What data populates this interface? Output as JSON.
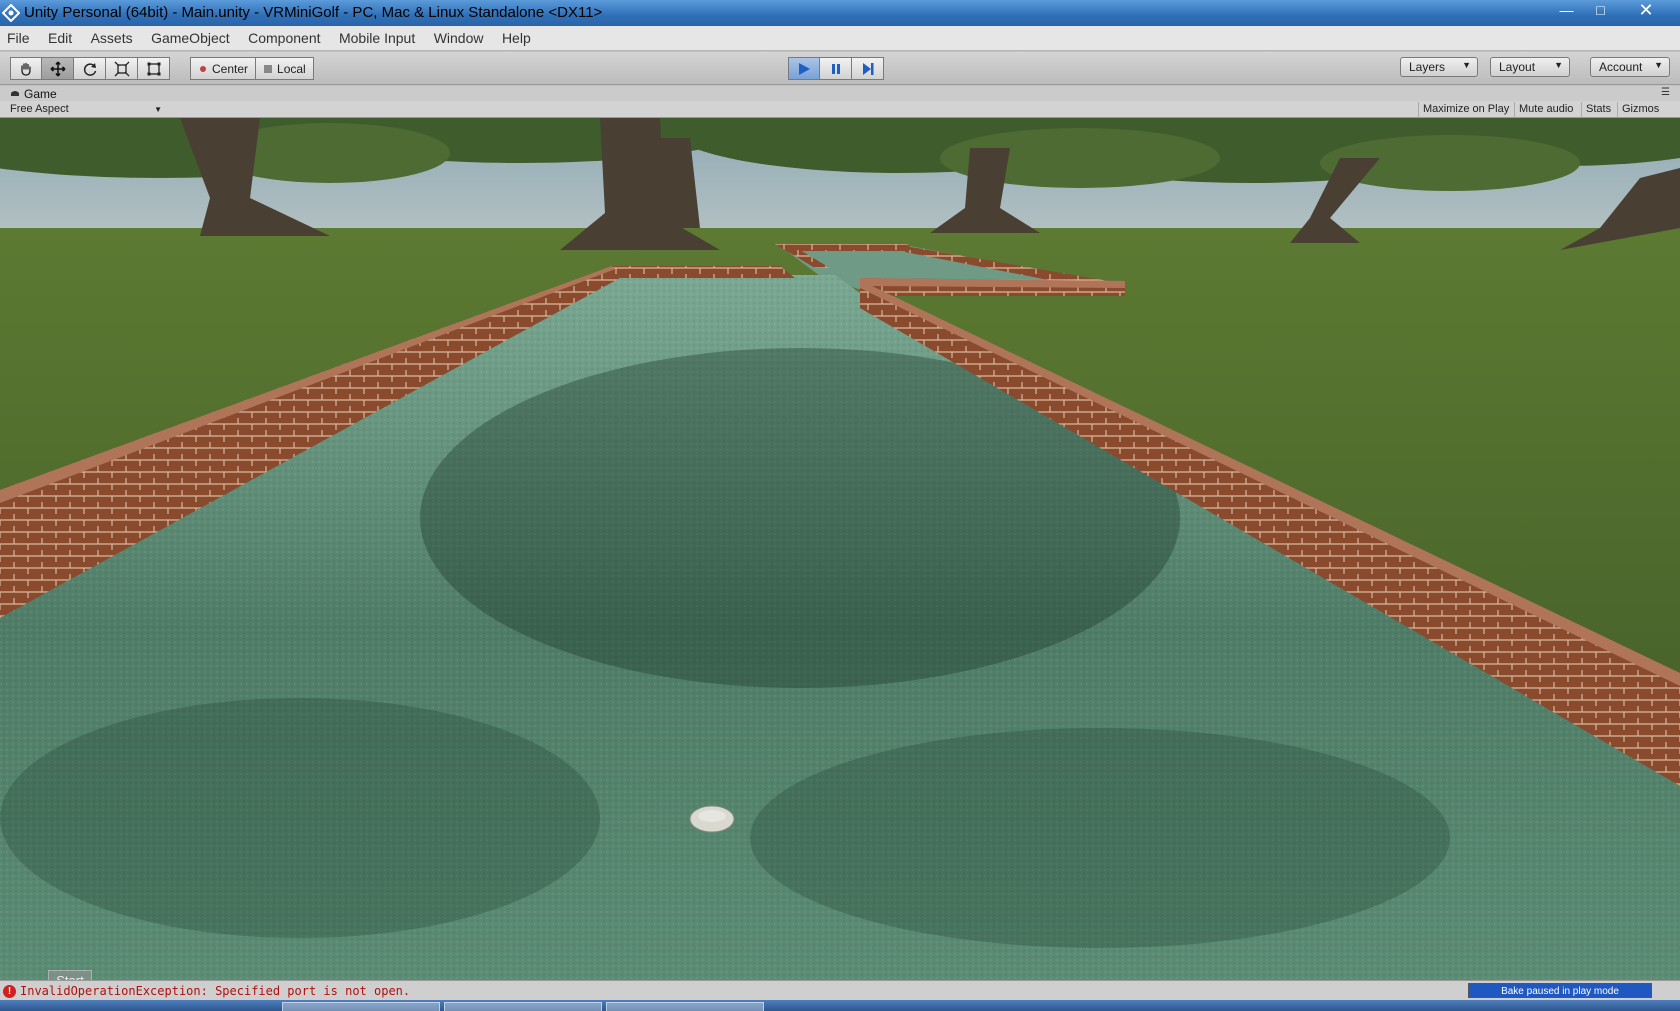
{
  "window": {
    "title": "Unity Personal (64bit) - Main.unity - VRMiniGolf - PC, Mac & Linux Standalone <DX11>",
    "minimize_glyph": "—",
    "maximize_glyph": "□",
    "close_glyph": "✕"
  },
  "menu": [
    "File",
    "Edit",
    "Assets",
    "GameObject",
    "Component",
    "Mobile Input",
    "Window",
    "Help"
  ],
  "toolbar": {
    "tools": [
      "hand-icon",
      "move-icon",
      "rotate-icon",
      "scale-icon",
      "rect-icon"
    ],
    "active_tool": "move-icon",
    "pivot_mode": "Center",
    "pivot_space": "Local",
    "play_state": "playing",
    "layers_label": "Layers",
    "layout_label": "Layout",
    "account_label": "Account"
  },
  "game_panel": {
    "tab_label": "Game",
    "aspect": "Free Aspect",
    "toggles": [
      "Maximize on Play",
      "Mute audio",
      "Stats",
      "Gizmos"
    ]
  },
  "overlay": {
    "start_label": "Start"
  },
  "status": {
    "message": "InvalidOperationException: Specified port is not open.",
    "bake": "Bake paused in play mode"
  },
  "colors": {
    "accent": "#1e58c0",
    "error": "#d02020"
  }
}
